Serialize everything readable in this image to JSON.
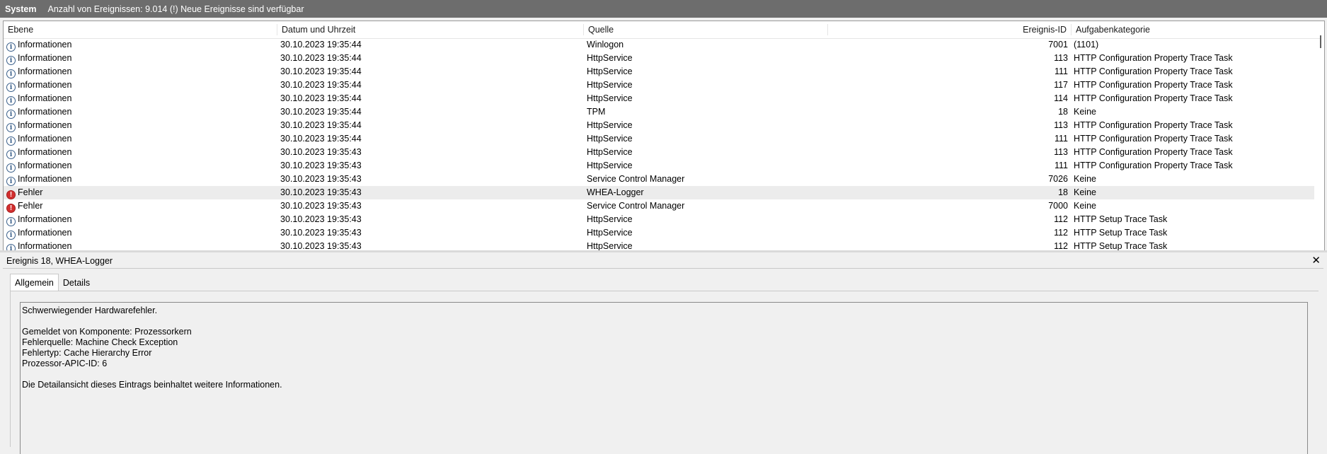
{
  "topbar": {
    "title": "System",
    "info": "Anzahl von Ereignissen: 9.014 (!) Neue Ereignisse sind verfügbar"
  },
  "columns": {
    "level": "Ebene",
    "date": "Datum und Uhrzeit",
    "source": "Quelle",
    "id": "Ereignis-ID",
    "category": "Aufgabenkategorie"
  },
  "rows": [
    {
      "icon": "info-icon",
      "level": "Informationen",
      "date": "30.10.2023 19:35:44",
      "source": "Winlogon",
      "id": "7001",
      "category": "(1101)"
    },
    {
      "icon": "info-icon",
      "level": "Informationen",
      "date": "30.10.2023 19:35:44",
      "source": "HttpService",
      "id": "113",
      "category": "HTTP Configuration Property Trace Task"
    },
    {
      "icon": "info-icon",
      "level": "Informationen",
      "date": "30.10.2023 19:35:44",
      "source": "HttpService",
      "id": "111",
      "category": "HTTP Configuration Property Trace Task"
    },
    {
      "icon": "info-icon",
      "level": "Informationen",
      "date": "30.10.2023 19:35:44",
      "source": "HttpService",
      "id": "117",
      "category": "HTTP Configuration Property Trace Task"
    },
    {
      "icon": "info-icon",
      "level": "Informationen",
      "date": "30.10.2023 19:35:44",
      "source": "HttpService",
      "id": "114",
      "category": "HTTP Configuration Property Trace Task"
    },
    {
      "icon": "info-icon",
      "level": "Informationen",
      "date": "30.10.2023 19:35:44",
      "source": "TPM",
      "id": "18",
      "category": "Keine"
    },
    {
      "icon": "info-icon",
      "level": "Informationen",
      "date": "30.10.2023 19:35:44",
      "source": "HttpService",
      "id": "113",
      "category": "HTTP Configuration Property Trace Task"
    },
    {
      "icon": "info-icon",
      "level": "Informationen",
      "date": "30.10.2023 19:35:44",
      "source": "HttpService",
      "id": "111",
      "category": "HTTP Configuration Property Trace Task"
    },
    {
      "icon": "info-icon",
      "level": "Informationen",
      "date": "30.10.2023 19:35:43",
      "source": "HttpService",
      "id": "113",
      "category": "HTTP Configuration Property Trace Task"
    },
    {
      "icon": "info-icon",
      "level": "Informationen",
      "date": "30.10.2023 19:35:43",
      "source": "HttpService",
      "id": "111",
      "category": "HTTP Configuration Property Trace Task"
    },
    {
      "icon": "info-icon",
      "level": "Informationen",
      "date": "30.10.2023 19:35:43",
      "source": "Service Control Manager",
      "id": "7026",
      "category": "Keine"
    },
    {
      "icon": "error-icon",
      "level": "Fehler",
      "date": "30.10.2023 19:35:43",
      "source": "WHEA-Logger",
      "id": "18",
      "category": "Keine",
      "selected": true
    },
    {
      "icon": "error-icon",
      "level": "Fehler",
      "date": "30.10.2023 19:35:43",
      "source": "Service Control Manager",
      "id": "7000",
      "category": "Keine"
    },
    {
      "icon": "info-icon",
      "level": "Informationen",
      "date": "30.10.2023 19:35:43",
      "source": "HttpService",
      "id": "112",
      "category": "HTTP Setup Trace Task"
    },
    {
      "icon": "info-icon",
      "level": "Informationen",
      "date": "30.10.2023 19:35:43",
      "source": "HttpService",
      "id": "112",
      "category": "HTTP Setup Trace Task"
    },
    {
      "icon": "info-icon",
      "level": "Informationen",
      "date": "30.10.2023 19:35:43",
      "source": "HttpService",
      "id": "112",
      "category": "HTTP Setup Trace Task"
    }
  ],
  "detail": {
    "title": "Ereignis 18, WHEA-Logger",
    "close": "✕",
    "tabs": [
      "Allgemein",
      "Details"
    ],
    "lines": [
      "Schwerwiegender Hardwarefehler.",
      "",
      "Gemeldet von Komponente: Prozessorkern",
      "Fehlerquelle: Machine Check Exception",
      "Fehlertyp: Cache Hierarchy Error",
      "Prozessor-APIC-ID: 6",
      "",
      "Die Detailansicht dieses Eintrags beinhaltet weitere Informationen."
    ]
  }
}
